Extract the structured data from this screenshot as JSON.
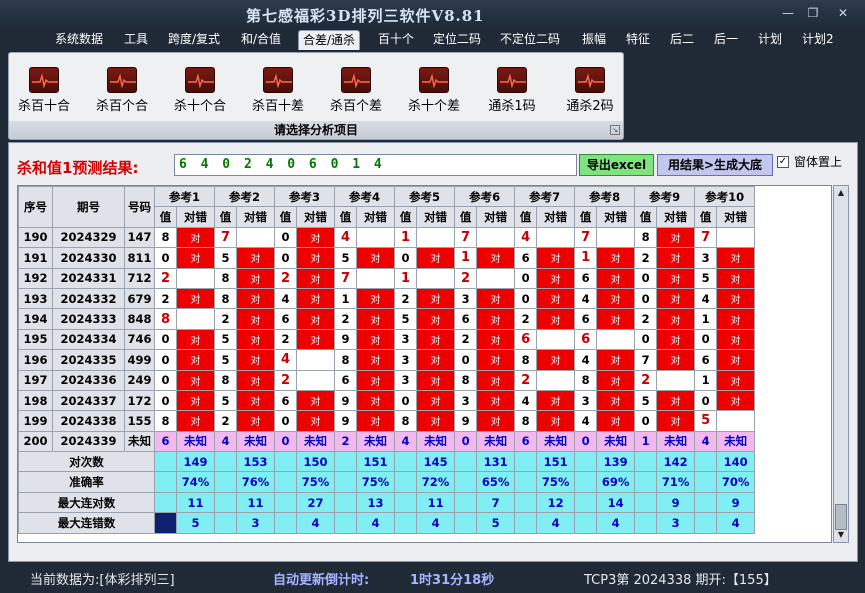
{
  "app": {
    "title": "第七感福彩3D排列三软件V8.81"
  },
  "window": {
    "minimize": "—",
    "restore": "❐",
    "close": "✕"
  },
  "menu": [
    "系统数据",
    "工具",
    "跨度/复式",
    "和/合值",
    "合差/通杀",
    "百十个",
    "定位二码",
    "不定位二码",
    "振幅",
    "特征",
    "后二",
    "后一",
    "计划",
    "计划2"
  ],
  "menu_active": "合差/通杀",
  "ribbon": {
    "buttons": [
      "杀百十合",
      "杀百个合",
      "杀十个合",
      "杀百十差",
      "杀百个差",
      "杀十个差",
      "通杀1码",
      "通杀2码"
    ],
    "caption": "请选择分析项目"
  },
  "result": {
    "label": "杀和值1预测结果:",
    "value": "6 4 0 2 4 0 6 0 1 4",
    "export_label": "导出excel",
    "generate_label": "用结果>生成大底",
    "topmost_label": "窗体置上",
    "topmost_checked": "✓"
  },
  "table": {
    "headers": {
      "seq": "序号",
      "period": "期号",
      "number": "号码"
    },
    "groups": [
      "参考1",
      "参考2",
      "参考3",
      "参考4",
      "参考5",
      "参考6",
      "参考7",
      "参考8",
      "参考9",
      "参考10"
    ],
    "sub_headers": [
      "值",
      "对错"
    ],
    "hit_text": "对",
    "hot_color": "#c40000",
    "hit_color": "#ee0000",
    "rows": [
      {
        "seq": "190",
        "period": "2024329",
        "number": "147",
        "vals": [
          8,
          7,
          0,
          4,
          1,
          7,
          4,
          7,
          8,
          7
        ],
        "hits": [
          1,
          0,
          1,
          0,
          0,
          0,
          0,
          0,
          1,
          0
        ],
        "hot": [
          0,
          1,
          0,
          1,
          1,
          1,
          1,
          1,
          0,
          1
        ]
      },
      {
        "seq": "191",
        "period": "2024330",
        "number": "811",
        "vals": [
          0,
          5,
          0,
          5,
          0,
          1,
          6,
          1,
          2,
          3
        ],
        "hits": [
          1,
          1,
          1,
          1,
          1,
          1,
          1,
          1,
          1,
          1
        ],
        "hot": [
          0,
          0,
          0,
          0,
          0,
          1,
          0,
          1,
          0,
          0
        ]
      },
      {
        "seq": "192",
        "period": "2024331",
        "number": "712",
        "vals": [
          2,
          8,
          2,
          7,
          1,
          2,
          0,
          6,
          0,
          5
        ],
        "hits": [
          0,
          1,
          1,
          0,
          0,
          0,
          1,
          1,
          1,
          1
        ],
        "hot": [
          1,
          0,
          1,
          1,
          1,
          1,
          0,
          0,
          0,
          0
        ]
      },
      {
        "seq": "193",
        "period": "2024332",
        "number": "679",
        "vals": [
          2,
          8,
          4,
          1,
          2,
          3,
          0,
          4,
          0,
          4
        ],
        "hits": [
          1,
          1,
          1,
          1,
          1,
          1,
          1,
          1,
          1,
          1
        ],
        "hot": [
          0,
          0,
          0,
          0,
          0,
          0,
          0,
          0,
          0,
          0
        ]
      },
      {
        "seq": "194",
        "period": "2024333",
        "number": "848",
        "vals": [
          8,
          2,
          6,
          2,
          5,
          6,
          2,
          6,
          2,
          1
        ],
        "hits": [
          0,
          1,
          1,
          1,
          1,
          1,
          1,
          1,
          1,
          1
        ],
        "hot": [
          1,
          0,
          0,
          0,
          0,
          0,
          0,
          0,
          0,
          0
        ]
      },
      {
        "seq": "195",
        "period": "2024334",
        "number": "746",
        "vals": [
          0,
          5,
          2,
          9,
          3,
          2,
          6,
          6,
          0,
          0
        ],
        "hits": [
          1,
          1,
          1,
          1,
          1,
          1,
          0,
          0,
          1,
          1
        ],
        "hot": [
          0,
          0,
          0,
          0,
          0,
          0,
          1,
          1,
          0,
          0
        ]
      },
      {
        "seq": "196",
        "period": "2024335",
        "number": "499",
        "vals": [
          0,
          5,
          4,
          8,
          3,
          0,
          8,
          4,
          7,
          6
        ],
        "hits": [
          1,
          1,
          0,
          1,
          1,
          1,
          1,
          1,
          1,
          1
        ],
        "hot": [
          0,
          0,
          1,
          0,
          0,
          0,
          0,
          0,
          0,
          0
        ]
      },
      {
        "seq": "197",
        "period": "2024336",
        "number": "249",
        "vals": [
          0,
          8,
          2,
          6,
          3,
          8,
          2,
          8,
          2,
          1
        ],
        "hits": [
          1,
          1,
          0,
          1,
          1,
          1,
          0,
          1,
          0,
          1
        ],
        "hot": [
          0,
          0,
          1,
          0,
          0,
          0,
          1,
          0,
          1,
          0
        ]
      },
      {
        "seq": "198",
        "period": "2024337",
        "number": "172",
        "vals": [
          0,
          5,
          6,
          9,
          0,
          3,
          4,
          3,
          5,
          0
        ],
        "hits": [
          1,
          1,
          1,
          1,
          1,
          1,
          1,
          1,
          1,
          1
        ],
        "hot": [
          0,
          0,
          0,
          0,
          0,
          0,
          0,
          0,
          0,
          0
        ]
      },
      {
        "seq": "199",
        "period": "2024338",
        "number": "155",
        "vals": [
          8,
          2,
          0,
          9,
          8,
          9,
          8,
          4,
          0,
          5
        ],
        "hits": [
          1,
          1,
          1,
          1,
          1,
          1,
          1,
          1,
          1,
          0
        ],
        "hot": [
          0,
          0,
          0,
          0,
          0,
          0,
          0,
          0,
          0,
          1
        ]
      }
    ],
    "prediction": {
      "seq": "200",
      "period": "2024339",
      "number": "未知",
      "vals": [
        "6",
        "4",
        "0",
        "2",
        "4",
        "0",
        "6",
        "0",
        "1",
        "4"
      ],
      "status": "未知"
    },
    "stats": [
      {
        "label": "对次数",
        "values": [
          "149",
          "153",
          "150",
          "151",
          "145",
          "131",
          "151",
          "139",
          "142",
          "140"
        ]
      },
      {
        "label": "准确率",
        "values": [
          "74%",
          "76%",
          "75%",
          "75%",
          "72%",
          "65%",
          "75%",
          "69%",
          "71%",
          "70%"
        ]
      },
      {
        "label": "最大连对数",
        "values": [
          "11",
          "11",
          "27",
          "13",
          "11",
          "7",
          "12",
          "14",
          "9",
          "9"
        ]
      },
      {
        "label": "最大连错数",
        "values": [
          "5",
          "3",
          "4",
          "4",
          "4",
          "5",
          "4",
          "4",
          "3",
          "4"
        ]
      }
    ]
  },
  "status": {
    "current_data": "当前数据为:[体彩排列三]",
    "countdown_label": "自动更新倒计时:",
    "countdown_value": "1时31分18秒",
    "issue": "TCP3第 2024338 期开:【155】"
  }
}
